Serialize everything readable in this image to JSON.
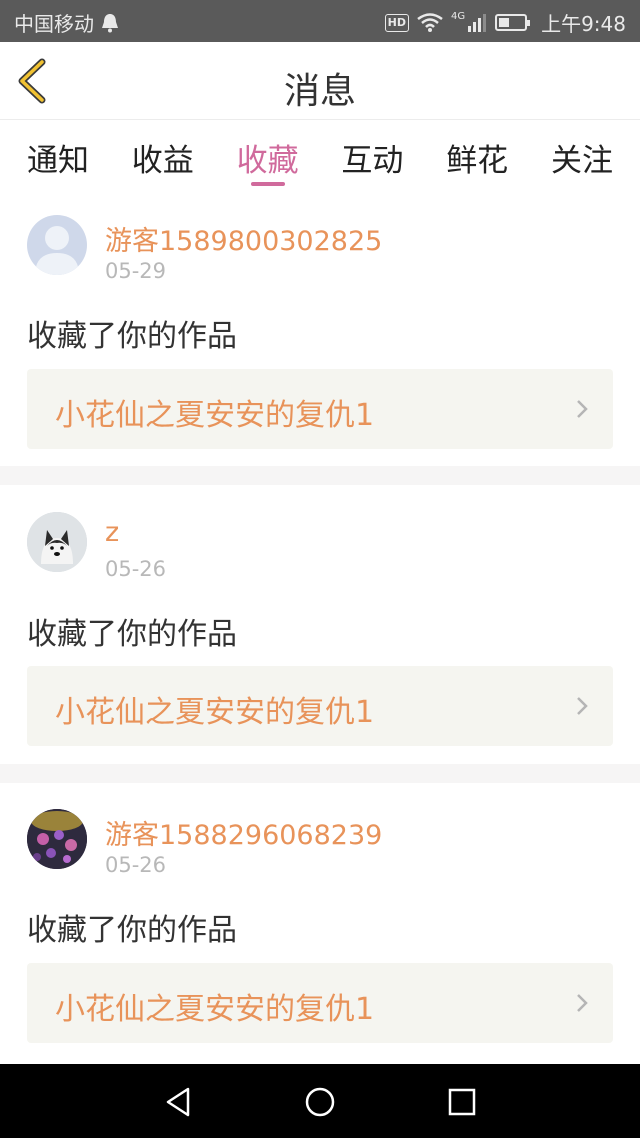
{
  "status_bar": {
    "carrier": "中国移动",
    "network": "4G",
    "hd_badge": "HD",
    "time": "上午9:48",
    "icons": [
      "notification-bell-icon",
      "wifi-icon",
      "signal-icon",
      "battery-icon"
    ]
  },
  "header": {
    "title": "消息",
    "back_icon": "chevron-left-icon"
  },
  "tabs": [
    {
      "label": "通知",
      "active": false
    },
    {
      "label": "收益",
      "active": false
    },
    {
      "label": "收藏",
      "active": true
    },
    {
      "label": "互动",
      "active": false
    },
    {
      "label": "鲜花",
      "active": false
    },
    {
      "label": "关注",
      "active": false
    }
  ],
  "messages": [
    {
      "username": "游客1589800302825",
      "date": "05-29",
      "action": "收藏了你的作品",
      "work_title": "小花仙之夏安安的复仇1",
      "avatar": "default-avatar"
    },
    {
      "username": "z",
      "date": "05-26",
      "action": "收藏了你的作品",
      "work_title": "小花仙之夏安安的复仇1",
      "avatar": "dog-avatar"
    },
    {
      "username": "游客1588296068239",
      "date": "05-26",
      "action": "收藏了你的作品",
      "work_title": "小花仙之夏安安的复仇1",
      "avatar": "flower-avatar"
    }
  ],
  "colors": {
    "accent": "#d06a9c",
    "username": "#e8935a",
    "work_bg": "#f5f5f0"
  },
  "nav_bar": {
    "icons": [
      "back-triangle-icon",
      "home-circle-icon",
      "recents-square-icon"
    ]
  }
}
